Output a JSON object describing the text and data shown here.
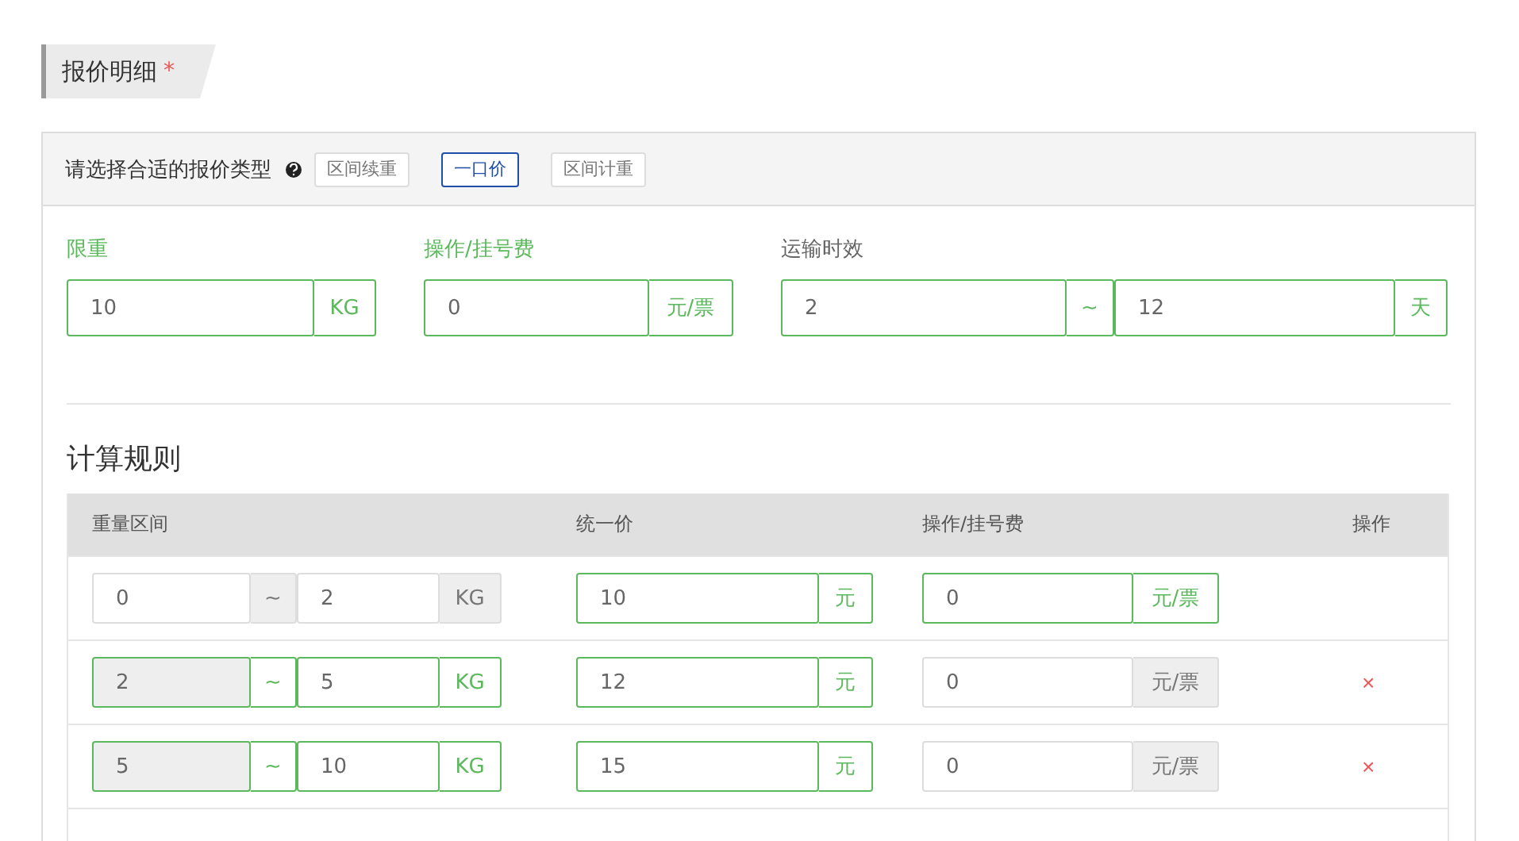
{
  "section": {
    "title": "报价明细",
    "required_mark": "*"
  },
  "quote_type": {
    "label": "请选择合适的报价类型",
    "options": [
      {
        "label": "区间续重",
        "selected": false
      },
      {
        "label": "一口价",
        "selected": true
      },
      {
        "label": "区间计重",
        "selected": false
      }
    ]
  },
  "fields": [
    {
      "kind": "single",
      "label": "限重",
      "highlighted": true,
      "value": "10",
      "unit": "KG"
    },
    {
      "kind": "single",
      "label": "操作/挂号费",
      "highlighted": true,
      "value": "0",
      "unit": "元/票"
    },
    {
      "kind": "range",
      "label": "运输时效",
      "highlighted": false,
      "from": "2",
      "separator": "~",
      "to": "12",
      "unit": "天"
    }
  ],
  "rules": {
    "title": "计算规则",
    "columns": [
      "重量区间",
      "统一价",
      "操作/挂号费",
      "操作"
    ],
    "rows": [
      {
        "weight": {
          "from": "0",
          "from_disabled": false,
          "separator": "~",
          "to": "2",
          "unit": "KG",
          "active": false
        },
        "price": {
          "value": "10",
          "unit": "元",
          "active": true
        },
        "fee": {
          "value": "0",
          "unit": "元/票",
          "active": true
        }
      },
      {
        "weight": {
          "from": "2",
          "from_disabled": true,
          "separator": "~",
          "to": "5",
          "unit": "KG",
          "active": true
        },
        "price": {
          "value": "12",
          "unit": "元",
          "active": true
        },
        "fee": {
          "value": "0",
          "unit": "元/票",
          "active": false
        },
        "remove": "×"
      },
      {
        "weight": {
          "from": "5",
          "from_disabled": true,
          "separator": "~",
          "to": "10",
          "unit": "KG",
          "active": true
        },
        "price": {
          "value": "15",
          "unit": "元",
          "active": true
        },
        "fee": {
          "value": "0",
          "unit": "元/票",
          "active": false
        },
        "remove": "×"
      }
    ]
  }
}
